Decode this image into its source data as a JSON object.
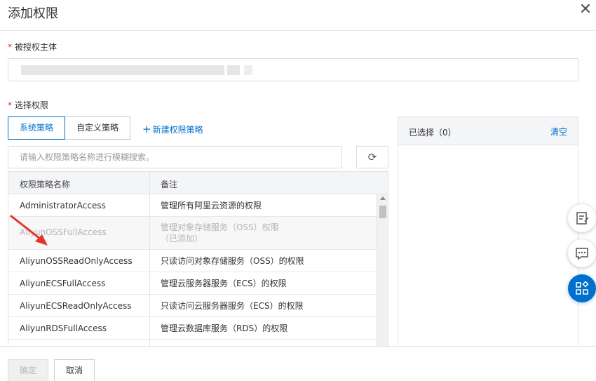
{
  "dialog": {
    "title": "添加权限",
    "close_icon": "close-icon"
  },
  "principal": {
    "required_mark": "*",
    "label": "被授权主体",
    "value_obscured": true
  },
  "permissions": {
    "required_mark": "*",
    "label": "选择权限",
    "tabs": [
      {
        "label": "系统策略",
        "active": true
      },
      {
        "label": "自定义策略",
        "active": false
      }
    ],
    "new_policy": {
      "icon": "plus-icon",
      "label": "新建权限策略"
    },
    "search_placeholder": "请输入权限策略名称进行模糊搜索。",
    "refresh_icon": "refresh-icon",
    "columns": [
      "权限策略名称",
      "备注"
    ],
    "rows": [
      {
        "name": "AdministratorAccess",
        "note": "管理所有阿里云资源的权限",
        "added": false
      },
      {
        "name": "AliyunOSSFullAccess",
        "note": "管理对象存储服务（OSS）权限",
        "note2": "（已添加）",
        "added": true
      },
      {
        "name": "AliyunOSSReadOnlyAccess",
        "note": "只读访问对象存储服务（OSS）的权限",
        "added": false
      },
      {
        "name": "AliyunECSFullAccess",
        "note": "管理云服务器服务（ECS）的权限",
        "added": false
      },
      {
        "name": "AliyunECSReadOnlyAccess",
        "note": "只读访问云服务器服务（ECS）的权限",
        "added": false
      },
      {
        "name": "AliyunRDSFullAccess",
        "note": "管理云数据库服务（RDS）的权限",
        "added": false
      }
    ]
  },
  "selected": {
    "label": "已选择（0）",
    "clear": "清空"
  },
  "side_buttons": [
    "feedback-icon",
    "chat-icon",
    "apps-icon"
  ],
  "footer": {
    "ok": "确定",
    "cancel": "取消"
  },
  "colors": {
    "accent": "#0070cc",
    "required": "#e0301e",
    "annotation_arrow": "#e8332a"
  }
}
